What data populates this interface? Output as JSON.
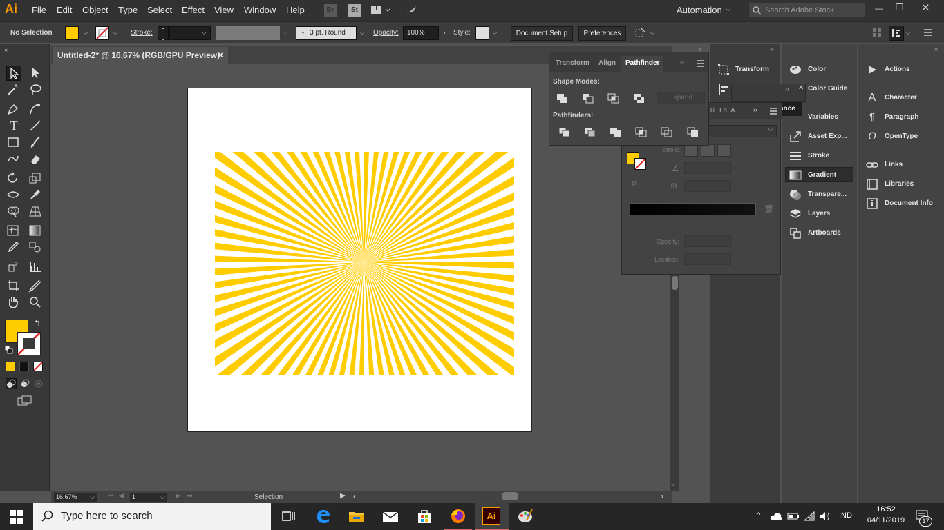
{
  "app": {
    "logo": "Ai",
    "brand_color": "#ff9a00"
  },
  "menu": [
    "File",
    "Edit",
    "Object",
    "Type",
    "Select",
    "Effect",
    "View",
    "Window",
    "Help"
  ],
  "menu_right": {
    "workspace": "Automation",
    "search_placeholder": "Search Adobe Stock"
  },
  "control_bar": {
    "selection_state": "No Selection",
    "fill_color": "#ffcc00",
    "stroke_label": "Stroke:",
    "brush_value": "3 pt. Round",
    "opacity_label": "Opacity:",
    "opacity_value": "100%",
    "style_label": "Style:",
    "document_setup": "Document Setup",
    "preferences": "Preferences"
  },
  "document": {
    "tab_title": "Untitled-2* @ 16,67% (RGB/GPU Preview)",
    "close": "×"
  },
  "artwork": {
    "ray_color": "#ffcc00",
    "ray_count": 72
  },
  "status_bar": {
    "zoom": "16,67%",
    "artboard_number": "1",
    "status_text": "Selection"
  },
  "pathfinder_panel": {
    "tabs": [
      "Transform",
      "Align",
      "Pathfinder"
    ],
    "shape_modes_label": "Shape Modes:",
    "expand_label": "Expand",
    "pathfinders_label": "Pathfinders:"
  },
  "gradient_panel": {
    "tabs": [
      "Ti",
      "La",
      "A"
    ],
    "stroke_label": "Stroke:",
    "opacity_label": "Opacity:",
    "location_label": "Location:",
    "appearance_tab": "ance"
  },
  "dock_col1": {
    "transform": "Transform"
  },
  "dock_col2": [
    "Color",
    "Color Guide",
    "Variables",
    "Asset Exp...",
    "Stroke",
    "Gradient",
    "Transpare...",
    "Layers",
    "Artboards"
  ],
  "dock_col3": [
    "Actions",
    "Character",
    "Paragraph",
    "OpenType",
    "Links",
    "Libraries",
    "Document Info"
  ],
  "taskbar": {
    "search_placeholder": "Type here to search",
    "language": "IND",
    "time": "16:52",
    "date": "04/11/2019",
    "notifications": "17"
  }
}
